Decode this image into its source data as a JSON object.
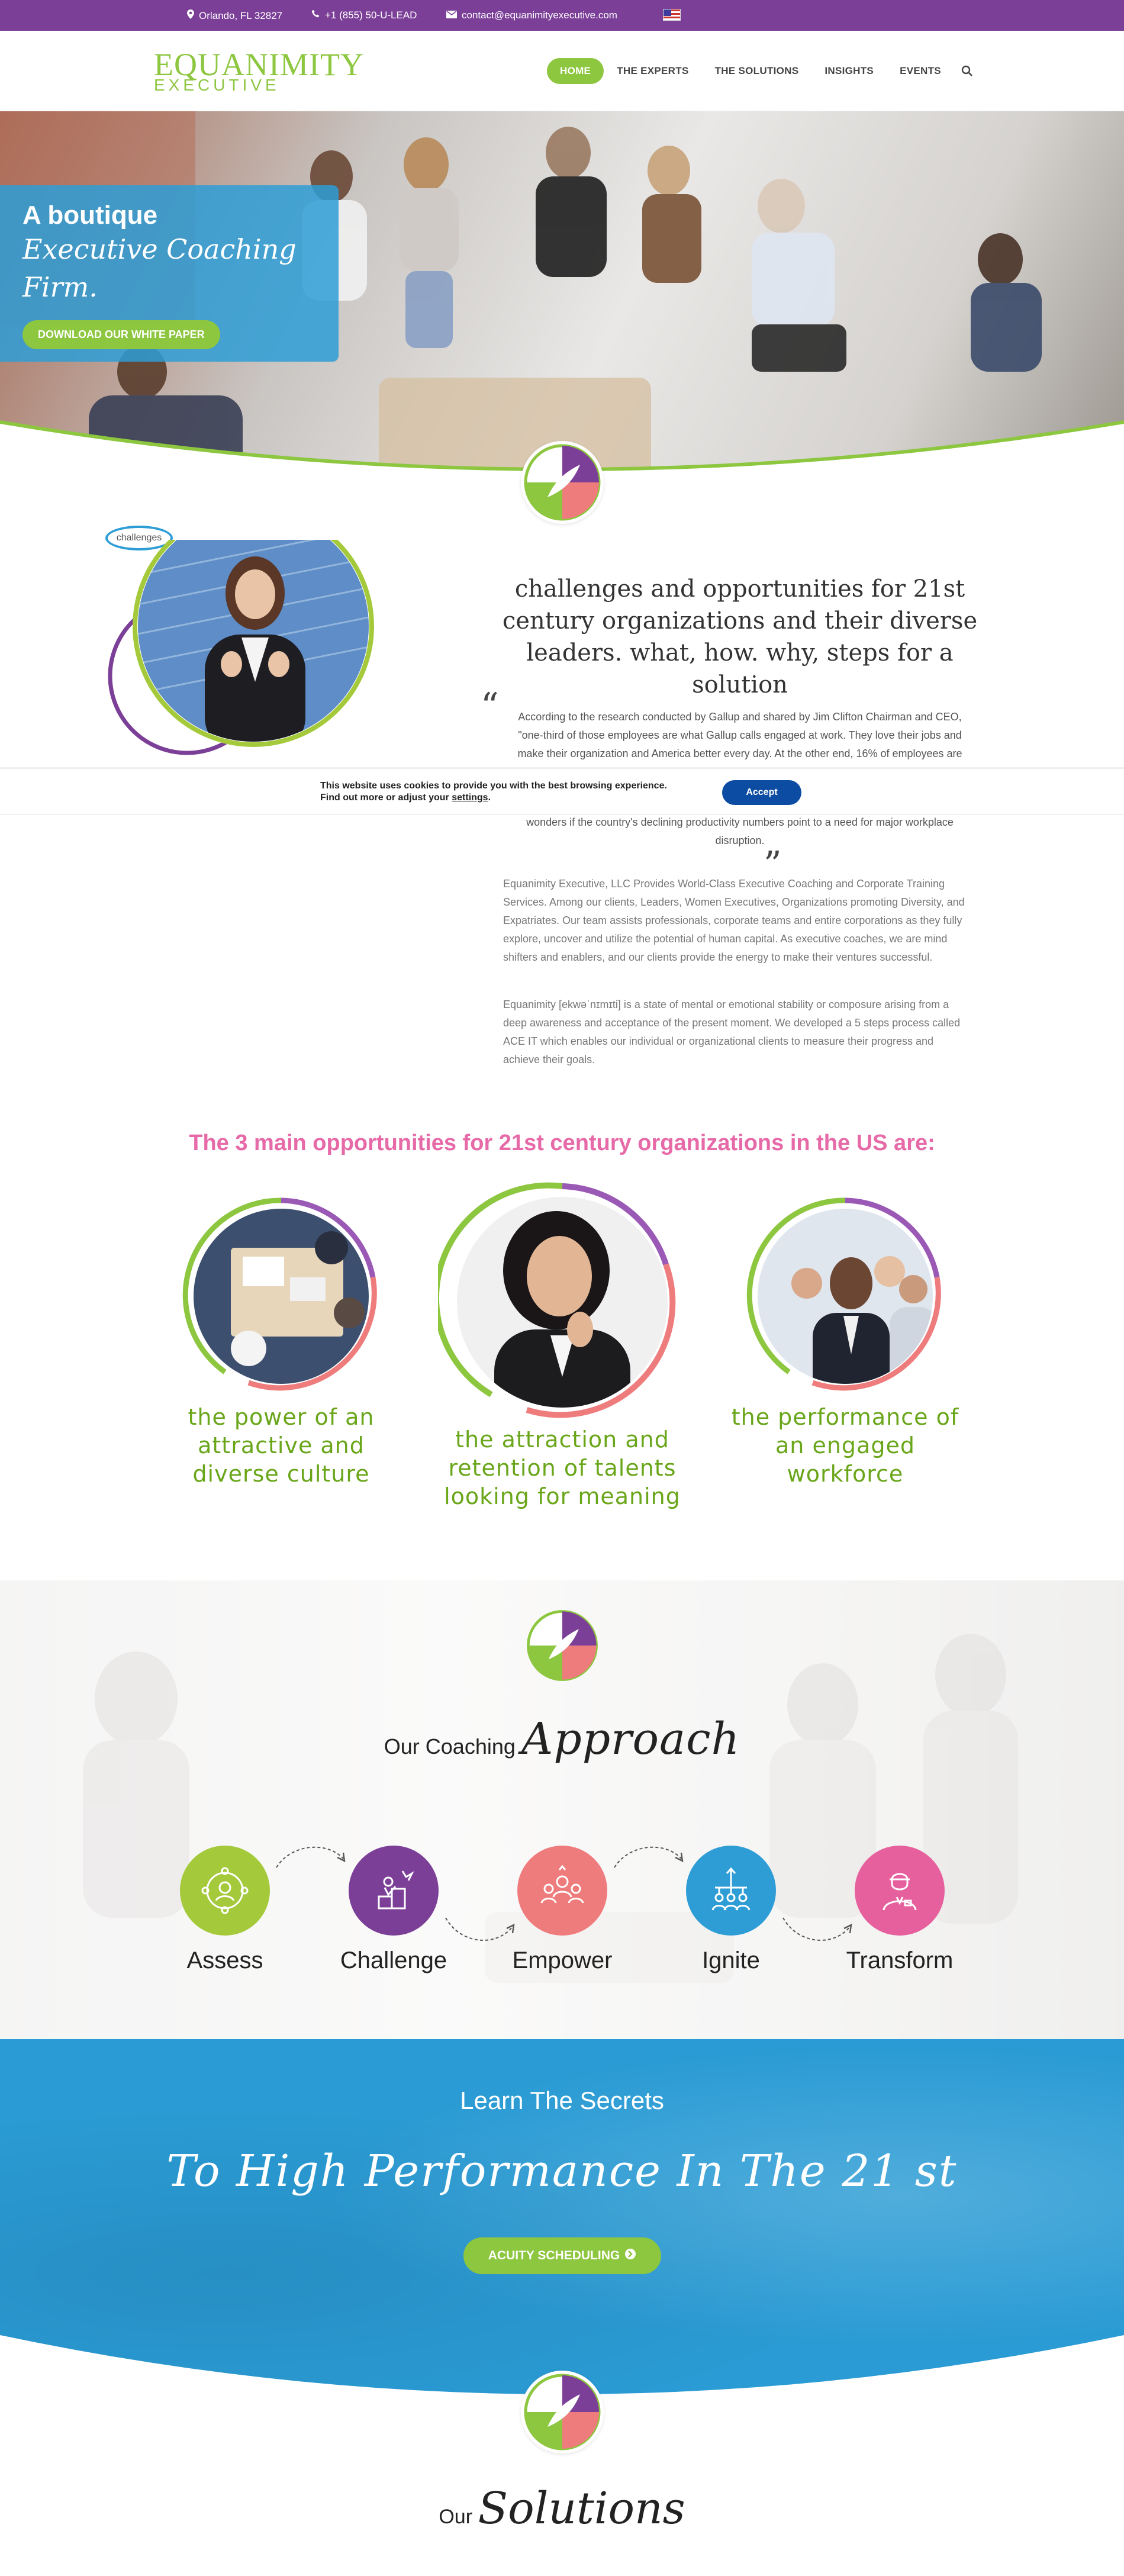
{
  "topbar": {
    "location": "Orlando, FL 32827",
    "phone": "+1 (855) 50-U-LEAD",
    "email": "contact@equanimityexecutive.com"
  },
  "logo": {
    "big": "EQUANIMITY",
    "small": "EXECUTIVE"
  },
  "nav": {
    "items": [
      "HOME",
      "THE EXPERTS",
      "THE SOLUTIONS",
      "INSIGHTS",
      "EVENTS"
    ],
    "active": "HOME"
  },
  "hero": {
    "line1": "A boutique",
    "line2": "Executive Coaching",
    "line3": "Firm.",
    "button": "DOWNLOAD OUR WHITE PAPER"
  },
  "intro": {
    "badge": "challenges",
    "heading": "challenges and opportunities for 21st century organizations and their diverse leaders. what, how. why, steps for a solution",
    "quote_visible": "According to the research conducted by Gallup and shared by Jim Clifton Chairman and CEO, \"one-third of those employees are what Gallup calls engaged at work. They love their jobs and make their organization and America better every day. At the other end, 16% of employees are",
    "quote_tail": "wonders if the country's declining productivity numbers point to a need for major workplace disruption.",
    "para1": "Equanimity Executive, LLC Provides World-Class Executive Coaching and Corporate Training Services. Among our clients, Leaders, Women Executives, Organizations promoting Diversity, and Expatriates. Our team assists professionals, corporate teams and entire corporations as they fully explore, uncover and utilize the potential of human capital. As executive coaches, we are mind shifters and enablers, and our clients provide the energy to make their ventures successful.",
    "para2": "Equanimity [ekwəˈnɪmɪti] is a state of mental or emotional stability or composure arising from a deep awareness and acceptance of the present moment. We developed a 5 steps process called ACE IT which enables our individual or organizational clients to measure their progress and achieve their goals."
  },
  "cookie": {
    "line1": "This website uses cookies to provide you with the best browsing experience.",
    "line2_prefix": "Find out more or adjust your ",
    "line2_link": "settings",
    "line2_suffix": ".",
    "accept": "Accept"
  },
  "opportunities": {
    "title": "The 3 main opportunities for 21st century organizations in the US are:",
    "items": [
      "the power of an attractive and diverse culture",
      "the attraction and retention of talents looking for meaning",
      "the performance of an engaged workforce"
    ]
  },
  "approach": {
    "prefix": "Our Coaching",
    "script": "Approach",
    "steps": [
      {
        "label": "Assess",
        "color": "#a4c93a"
      },
      {
        "label": "Challenge",
        "color": "#7b3f98"
      },
      {
        "label": "Empower",
        "color": "#ef7c7c"
      },
      {
        "label": "Ignite",
        "color": "#2e9dd6"
      },
      {
        "label": "Transform",
        "color": "#e6609e"
      }
    ]
  },
  "secrets": {
    "title": "Learn The Secrets",
    "script": "To High Performance In The 21 st",
    "button": "ACUITY SCHEDULING"
  },
  "solutions": {
    "prefix": "Our",
    "script": "Solutions"
  },
  "colors": {
    "purple": "#7b3f98",
    "green": "#8dc63f",
    "blue": "#2e9dd6",
    "pink": "#e76aa8",
    "coral": "#ef7c7c"
  }
}
